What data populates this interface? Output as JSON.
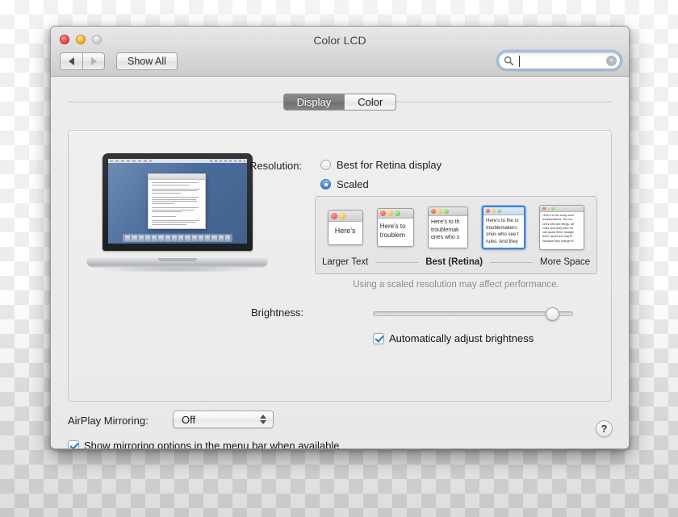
{
  "window": {
    "title": "Color LCD",
    "traffic_lights": [
      "close",
      "minimize",
      "zoom"
    ]
  },
  "toolbar": {
    "back_label": "◀",
    "forward_label": "▶",
    "show_all_label": "Show All",
    "search": {
      "value": "",
      "placeholder": "",
      "icon": "search-icon",
      "clear_icon": "×"
    }
  },
  "tabs": [
    {
      "label": "Display",
      "selected": true
    },
    {
      "label": "Color",
      "selected": false
    }
  ],
  "display": {
    "resolution_label": "Resolution:",
    "options": [
      {
        "label": "Best for Retina display",
        "selected": false
      },
      {
        "label": "Scaled",
        "selected": true
      }
    ],
    "scaled": {
      "thumbnails": [
        {
          "lines": [
            "Here's"
          ],
          "selected": false,
          "dots": 2
        },
        {
          "lines": [
            "Here's to",
            "troublem"
          ],
          "selected": false,
          "dots": 3
        },
        {
          "lines": [
            "Here's to th",
            "troublemak",
            "ones who s"
          ],
          "selected": false,
          "dots": 3
        },
        {
          "lines": [
            "Here's to the cr",
            "troublemakers.",
            "ones who see t",
            "rules. And they"
          ],
          "selected": true,
          "dots": 3
        },
        {
          "lines": [
            "Here's to the crazy ones",
            "troublemakers. The rou",
            "ones who see things, dif",
            "rules. And they have no",
            "can quote them, disagre",
            "them. About the only th",
            "because they change th"
          ],
          "selected": false,
          "dots": 3
        }
      ],
      "label_left": "Larger Text",
      "label_mid": "Best (Retina)",
      "label_right": "More Space"
    },
    "note": "Using a scaled resolution may affect performance.",
    "brightness_label": "Brightness:",
    "brightness_value": 92,
    "auto_brightness": {
      "label": "Automatically adjust brightness",
      "checked": true
    }
  },
  "airplay": {
    "label": "AirPlay Mirroring:",
    "value": "Off",
    "options": [
      "Off"
    ],
    "show_menu_bar": {
      "label": "Show mirroring options in the menu bar when available",
      "checked": true
    }
  },
  "help": {
    "label": "?"
  },
  "colors": {
    "accent": "#3a84d6",
    "window_bg": "#ececec",
    "tab_selected_bg": "#7b7b7b"
  }
}
